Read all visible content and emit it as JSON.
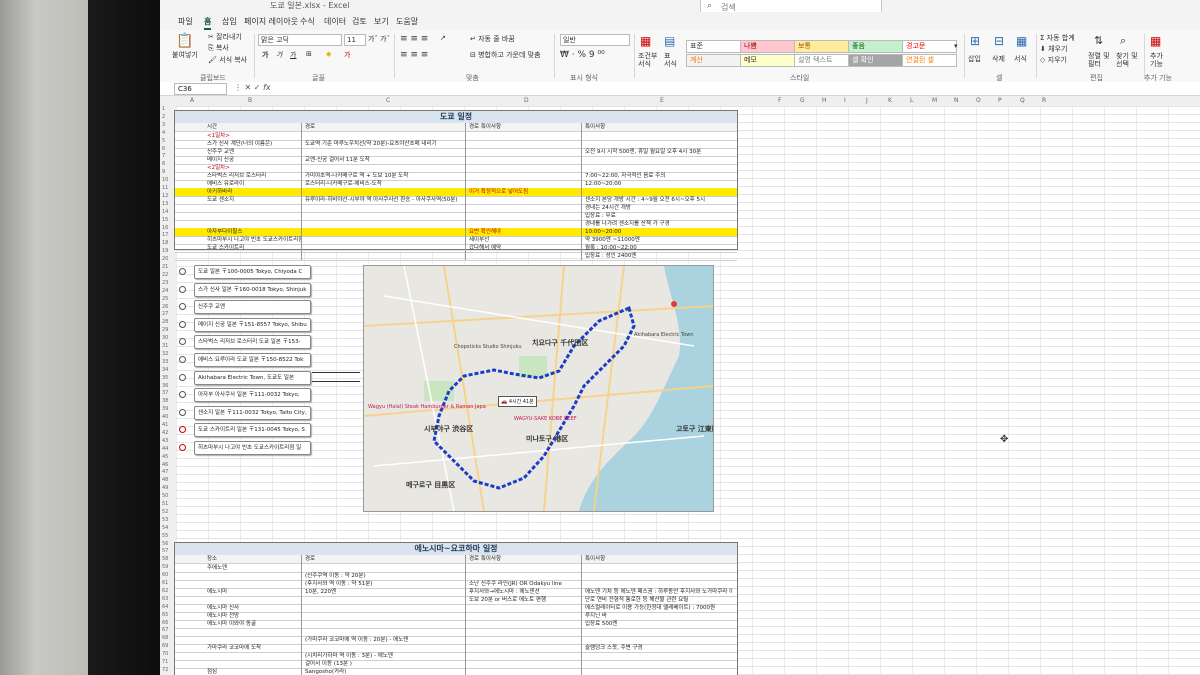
{
  "window": {
    "title": "도쿄 일본.xlsx - Excel",
    "search_placeholder": "검색"
  },
  "tabs": [
    "파일",
    "홈",
    "삽입",
    "페이지 레이아웃",
    "수식",
    "데이터",
    "검토",
    "보기",
    "도움말"
  ],
  "ribbon": {
    "clipboard": {
      "paste": "붙여넣기",
      "cut": "잘라내기",
      "copy": "복사",
      "format_painter": "서식 복사",
      "label": "클립보드"
    },
    "font": {
      "name": "맑은 고딕",
      "size": "11",
      "bold": "가",
      "italic": "가",
      "underline": "가",
      "label": "글꼴"
    },
    "alignment": {
      "wrap": "자동 줄 바꿈",
      "merge": "병합하고 가운데 맞춤",
      "label": "맞춤"
    },
    "number": {
      "format": "일반",
      "label": "표시 형식"
    },
    "styles": {
      "conditional": "조건부 서식",
      "table": "표 서식",
      "cells": [
        {
          "label": "표준",
          "bg": "#ffffff",
          "fg": "#333333"
        },
        {
          "label": "나쁨",
          "bg": "#ffc7ce",
          "fg": "#9c0006"
        },
        {
          "label": "보통",
          "bg": "#ffeb9c",
          "fg": "#9c5700"
        },
        {
          "label": "좋음",
          "bg": "#c6efce",
          "fg": "#006100"
        },
        {
          "label": "경고문",
          "bg": "#ffffff",
          "fg": "#ff0000"
        },
        {
          "label": "계산",
          "bg": "#f2f2f2",
          "fg": "#fa7d00"
        },
        {
          "label": "메모",
          "bg": "#ffffcc",
          "fg": "#333333"
        },
        {
          "label": "설명 텍스트",
          "bg": "#ffffff",
          "fg": "#7f7f7f"
        },
        {
          "label": "셀 확인",
          "bg": "#a5a5a5",
          "fg": "#ffffff"
        },
        {
          "label": "연결된 셀",
          "bg": "#ffffff",
          "fg": "#fa7d00"
        }
      ],
      "label": "스타일"
    },
    "cells": {
      "insert": "삽입",
      "delete": "삭제",
      "format": "서식",
      "label": "셀"
    },
    "editing": {
      "autosum": "자동 합계",
      "fill": "채우기",
      "clear": "지우기",
      "sort": "정렬 및 필터",
      "find": "찾기 및 선택",
      "label": "편집"
    },
    "addins": {
      "label": "추가 기능",
      "btn": "추가 기능"
    }
  },
  "formula_bar": {
    "name_box": "C36",
    "fx": "fx"
  },
  "columns": [
    "A",
    "B",
    "C",
    "D",
    "E",
    "F",
    "G",
    "H",
    "I",
    "J",
    "K",
    "L",
    "M",
    "N",
    "O",
    "P",
    "Q",
    "R"
  ],
  "tokyo": {
    "title": "도쿄 일정",
    "headers": [
      "시간",
      "경로",
      "경로 특이사항",
      "특이사항"
    ],
    "rows": [
      {
        "c1": "<1일차>",
        "c2": "",
        "c3": "",
        "c4": "",
        "red": true
      },
      {
        "c1": "스가 신사 계단(너의 이름은)",
        "c2": "도쿄역 기준 마루노우치선(약 20분)-요츠야산초메 내리기",
        "c3": "",
        "c4": ""
      },
      {
        "c1": "신주쿠 교엔",
        "c2": "",
        "c3": "",
        "c4": "오전 9시 시작 500엔, 휴일 월요일 오후 4시 30분"
      },
      {
        "c1": "메이지 신궁",
        "c2": "교엔-신궁 걸어서 11분 도착",
        "c3": "",
        "c4": ""
      },
      {
        "c1": "<2일차>",
        "c2": "",
        "c3": "",
        "c4": "",
        "red": true
      },
      {
        "c1": "스타벅스 리저브 로스터리",
        "c2": "가미야초역-나카메구로 역 + 도보 10분 도착",
        "c3": "",
        "c4": "7:00~22:00, 자극적인 음료 주의"
      },
      {
        "c1": "에비스 유로라이",
        "c2": "로스터리-나카메구로-에비스-도착",
        "c3": "",
        "c4": "12:00~20:00"
      },
      {
        "c1": "아키하바라",
        "c2": "",
        "c3": "이거 확정적으로 넣어도됨",
        "c4": "",
        "yellow": true
      },
      {
        "c1": "도쿄 센소지",
        "c2": "유루이라-히비야선-시부야 역 아사쿠사선 환승 - 아사쿠사역(50분)",
        "c3": "",
        "c4": "센소지 본당 개방 시간 : 4~9월 오전 6시~오후 5시"
      },
      {
        "c1": "",
        "c2": "",
        "c3": "",
        "c4": "경내는 24시간 개방"
      },
      {
        "c1": "",
        "c2": "",
        "c3": "",
        "c4": "입장료 : 무료"
      },
      {
        "c1": "",
        "c2": "",
        "c3": "",
        "c4": "경내를 나가려 센소지를 산책 가 구경"
      },
      {
        "c1": "아자부다이힐스",
        "c2": "",
        "c3": "요번 확인해야",
        "c4": "10:00~20:00",
        "yellow": true
      },
      {
        "c1": "히츠마부시 나고야 빈초 도쿄스카이트리점",
        "c2": "",
        "c3": "세이부선",
        "c4": "약 3900엔 ~11000엔"
      },
      {
        "c1": "도쿄 스카이트리",
        "c2": "",
        "c3": "갔다해서 예약",
        "c4": "월록 : 10:00~22:00"
      },
      {
        "c1": "",
        "c2": "",
        "c3": "",
        "c4": "입장료 : 성인 2400엔"
      }
    ]
  },
  "addresses": [
    "도쿄 일본 〒100-0005 Tokyo, Chiyoda C",
    "스가 신사 일본 〒160-0018 Tokyo, Shinjuk",
    "신주쿠 교엔",
    "메이지 신궁 일본 〒151-8557 Tokyo, Shibu",
    "스타벅스 리저브 로스터리 도쿄 일본 〒153-",
    "에비스 요루이라 도쿄 일본 〒150-8522 Tok",
    "Akihabara Electric Town, 도쿄도 일본",
    "아자부 아사쿠사 일본 〒111-0032 Tokyo,",
    "센소지 일본 〒111-0032 Tokyo, Taito City,",
    "도쿄 스카이트리 일본 〒131-0045 Tokyo, S",
    "히츠마부시 나고야 빈초 도쿄스카이트리점 일"
  ],
  "map": {
    "labels": [
      "치요다구 千代田区",
      "시부야구 渋谷区",
      "미나토구 港区",
      "메구로구 目黒区",
      "고토구 江東区",
      "Chopsticks Studio Shinjuku",
      "Akihabara Electric Town",
      "Wagyu (Halal) Steak Hamburger & Ramen Japa",
      "WAGYU-SAKE KOBE BEEF"
    ],
    "time_badge": "4시간 41분"
  },
  "enoshima": {
    "title": "에노시마~요코하마 일정",
    "headers": [
      "장소",
      "경로",
      "경로 특이사항",
      "특이사항"
    ],
    "rows": [
      {
        "c1": "주에노덴",
        "c2": "",
        "c3": "",
        "c4": ""
      },
      {
        "c1": "",
        "c2": "(신주쿠역 이동 : 약 20분)",
        "c3": "",
        "c4": ""
      },
      {
        "c1": "",
        "c2": "(후지사와 역 이동 : 약 51분)",
        "c3": "소난 신주쿠 라인(JR) OR Odakyu line",
        "c4": ""
      },
      {
        "c1": "에노시마",
        "c2": "10분, 220엔",
        "c3": "후지사와→에노시마 : 에노덴선",
        "c4": "에노덴 기차 등 에노덴 패스권 : 하루동안 후지사와 노가마쿠라 이용가능 : 800엔"
      },
      {
        "c1": "",
        "c2": "",
        "c3": "도보 20분 or 버스로 에노토 편행",
        "c4": "단로 연비 전형적 통로한 등 해산물 관련 요릴"
      },
      {
        "c1": "에노시마 신사",
        "c2": "",
        "c3": "",
        "c4": "에스컬레이터로 이용 가능(한정대 엘레베이트) : 7000원"
      },
      {
        "c1": "에노시마 전망",
        "c2": "",
        "c3": "",
        "c4": "루지닌 바"
      },
      {
        "c1": "에노시마 이와야 동굴",
        "c2": "",
        "c3": "",
        "c4": "입장료 500엔"
      },
      {
        "c1": "",
        "c2": "",
        "c3": "",
        "c4": ""
      },
      {
        "c1": "",
        "c2": "(가마쿠라 코코마에 역 이동 : 20분) - 에노덴",
        "c3": "",
        "c4": ""
      },
      {
        "c1": "가마쿠라 코코마에 도착",
        "c2": "",
        "c3": "",
        "c4": "슬램덩크 스팟, 주변 구경"
      },
      {
        "c1": "",
        "c2": "(시치리가하마 역 이동 : 3분) - 에노덴",
        "c3": "",
        "c4": ""
      },
      {
        "c1": "",
        "c2": "걸어서 이동 (13분 )",
        "c3": "",
        "c4": ""
      },
      {
        "c1": "점심",
        "c2": "Sangosho(카라)",
        "c3": "",
        "c4": ""
      }
    ]
  }
}
